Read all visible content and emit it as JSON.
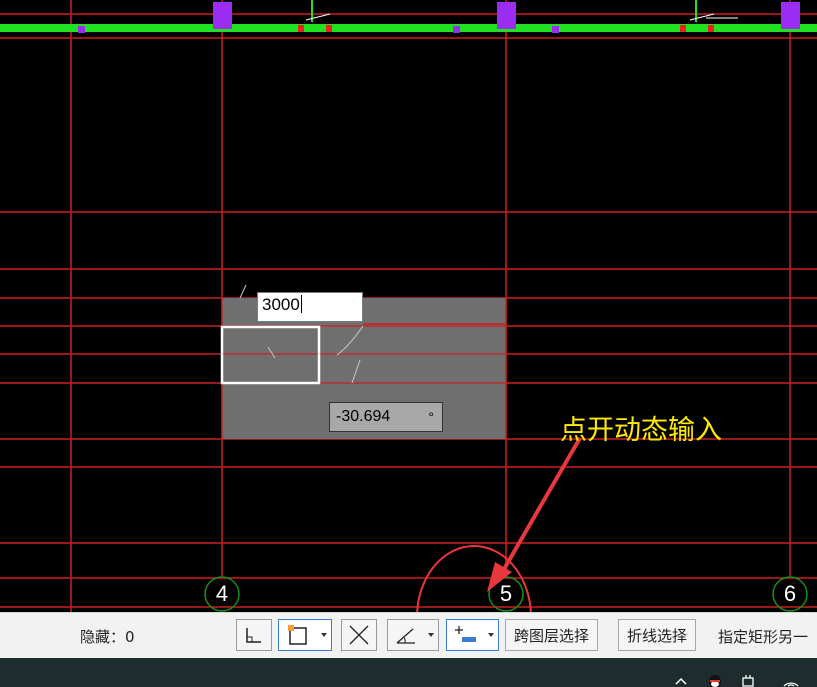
{
  "canvas": {
    "length_input": "3000",
    "angle_input": "-30.694",
    "angle_unit": "°",
    "axis_labels": [
      "4",
      "5",
      "6"
    ],
    "annotation": "点开动态输入",
    "colors": {
      "grid_line": "#cc1f1f",
      "wall": "#22e022",
      "column": "#9b2cf2",
      "selection_fill": "#6f6f6f",
      "axis_circle": "#1a8f1a",
      "annotation": "#ffea00",
      "callout": "#e8383d"
    }
  },
  "statusbar": {
    "hidden_label": "隐藏：0",
    "buttons": [
      {
        "icon": "ortho-icon"
      },
      {
        "icon": "object-snap-icon",
        "has_dropdown": true
      },
      {
        "icon": "intersection-icon"
      },
      {
        "icon": "polar-tracking-icon",
        "has_dropdown": true
      },
      {
        "icon": "dynamic-input-icon",
        "has_dropdown": true,
        "active": true
      }
    ],
    "cross_layer_select": "跨图层选择",
    "polyline_select": "折线选择",
    "prompt": "指定矩形另一"
  },
  "taskbar": {
    "tray_icons": [
      "chevron-up-icon",
      "qq-icon",
      "power-icon",
      "wifi-icon"
    ]
  }
}
